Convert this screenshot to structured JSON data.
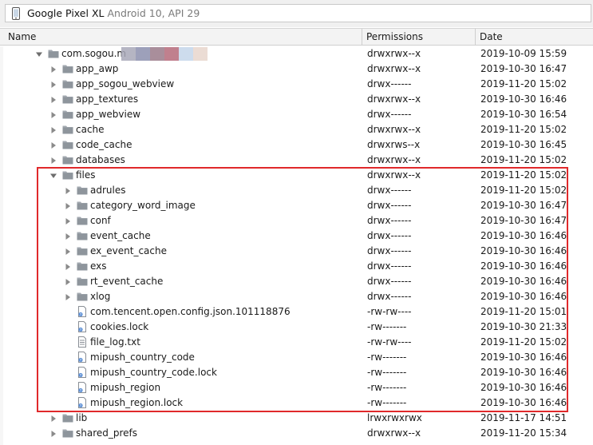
{
  "device": {
    "name": "Google Pixel XL",
    "api": "Android 10, API 29"
  },
  "columns": {
    "name": "Name",
    "permissions": "Permissions",
    "date": "Date"
  },
  "rows": [
    {
      "name": "com.sogou.m",
      "permissions": "drwxrwx--x",
      "date": "2019-10-09 15:59",
      "type": "folder",
      "depth": 0,
      "expanded": true,
      "redacted": true
    },
    {
      "name": "app_awp",
      "permissions": "drwxrwx--x",
      "date": "2019-10-30 16:47",
      "type": "folder",
      "depth": 1,
      "expanded": false
    },
    {
      "name": "app_sogou_webview",
      "permissions": "drwx------",
      "date": "2019-11-20 15:02",
      "type": "folder",
      "depth": 1,
      "expanded": false
    },
    {
      "name": "app_textures",
      "permissions": "drwxrwx--x",
      "date": "2019-10-30 16:46",
      "type": "folder",
      "depth": 1,
      "expanded": false
    },
    {
      "name": "app_webview",
      "permissions": "drwx------",
      "date": "2019-10-30 16:54",
      "type": "folder",
      "depth": 1,
      "expanded": false
    },
    {
      "name": "cache",
      "permissions": "drwxrwx--x",
      "date": "2019-11-20 15:02",
      "type": "folder",
      "depth": 1,
      "expanded": false
    },
    {
      "name": "code_cache",
      "permissions": "drwxrws--x",
      "date": "2019-10-30 16:45",
      "type": "folder",
      "depth": 1,
      "expanded": false
    },
    {
      "name": "databases",
      "permissions": "drwxrwx--x",
      "date": "2019-11-20 15:02",
      "type": "folder",
      "depth": 1,
      "expanded": false
    },
    {
      "name": "files",
      "permissions": "drwxrwx--x",
      "date": "2019-11-20 15:02",
      "type": "folder",
      "depth": 1,
      "expanded": true
    },
    {
      "name": "adrules",
      "permissions": "drwx------",
      "date": "2019-11-20 15:02",
      "type": "folder",
      "depth": 2,
      "expanded": false
    },
    {
      "name": "category_word_image",
      "permissions": "drwx------",
      "date": "2019-10-30 16:47",
      "type": "folder",
      "depth": 2,
      "expanded": false
    },
    {
      "name": "conf",
      "permissions": "drwx------",
      "date": "2019-10-30 16:47",
      "type": "folder",
      "depth": 2,
      "expanded": false
    },
    {
      "name": "event_cache",
      "permissions": "drwx------",
      "date": "2019-10-30 16:46",
      "type": "folder",
      "depth": 2,
      "expanded": false
    },
    {
      "name": "ex_event_cache",
      "permissions": "drwx------",
      "date": "2019-10-30 16:46",
      "type": "folder",
      "depth": 2,
      "expanded": false
    },
    {
      "name": "exs",
      "permissions": "drwx------",
      "date": "2019-10-30 16:46",
      "type": "folder",
      "depth": 2,
      "expanded": false
    },
    {
      "name": "rt_event_cache",
      "permissions": "drwx------",
      "date": "2019-10-30 16:46",
      "type": "folder",
      "depth": 2,
      "expanded": false
    },
    {
      "name": "xlog",
      "permissions": "drwx------",
      "date": "2019-10-30 16:46",
      "type": "folder",
      "depth": 2,
      "expanded": false
    },
    {
      "name": "com.tencent.open.config.json.101118876",
      "permissions": "-rw-rw----",
      "date": "2019-11-20 15:01",
      "type": "unknown-file",
      "depth": 2
    },
    {
      "name": "cookies.lock",
      "permissions": "-rw-------",
      "date": "2019-10-30 21:33",
      "type": "unknown-file",
      "depth": 2
    },
    {
      "name": "file_log.txt",
      "permissions": "-rw-rw----",
      "date": "2019-11-20 15:02",
      "type": "text-file",
      "depth": 2
    },
    {
      "name": "mipush_country_code",
      "permissions": "-rw-------",
      "date": "2019-10-30 16:46",
      "type": "unknown-file",
      "depth": 2
    },
    {
      "name": "mipush_country_code.lock",
      "permissions": "-rw-------",
      "date": "2019-10-30 16:46",
      "type": "unknown-file",
      "depth": 2
    },
    {
      "name": "mipush_region",
      "permissions": "-rw-------",
      "date": "2019-10-30 16:46",
      "type": "unknown-file",
      "depth": 2
    },
    {
      "name": "mipush_region.lock",
      "permissions": "-rw-------",
      "date": "2019-10-30 16:46",
      "type": "unknown-file",
      "depth": 2
    },
    {
      "name": "lib",
      "permissions": "lrwxrwxrwx",
      "date": "2019-11-17 14:51",
      "type": "folder",
      "depth": 1,
      "expanded": false
    },
    {
      "name": "shared_prefs",
      "permissions": "drwxrwx--x",
      "date": "2019-11-20 15:34",
      "type": "folder",
      "depth": 1,
      "expanded": false
    }
  ],
  "colors": {
    "highlight": "#e0292b",
    "folder": "#9aa0a6",
    "text": "#1a1a1a"
  },
  "icons": {
    "device": "phone-icon",
    "folder": "folder-icon",
    "file": "file-icon",
    "expand": "arrow-right-icon",
    "collapse": "arrow-down-icon"
  }
}
